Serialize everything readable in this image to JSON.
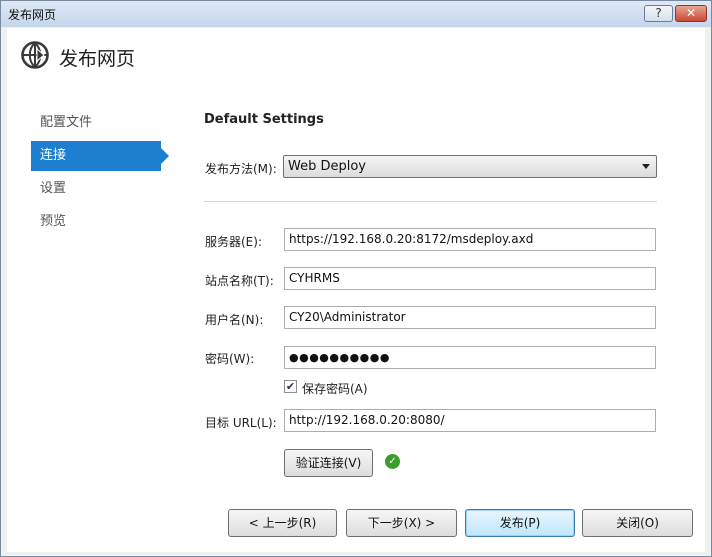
{
  "window": {
    "title": "发布网页",
    "help_label": "?",
    "close_label": "✕"
  },
  "header": {
    "title": "发布网页",
    "icon": "globe-publish-icon"
  },
  "nav": {
    "items": [
      {
        "label": "配置文件"
      },
      {
        "label": "连接"
      },
      {
        "label": "设置"
      },
      {
        "label": "预览"
      }
    ],
    "active_index": 1
  },
  "main": {
    "section_title": "Default Settings",
    "publish_method": {
      "label": "发布方法(M):",
      "value": "Web Deploy"
    },
    "server": {
      "label": "服务器(E):",
      "value": "https://192.168.0.20:8172/msdeploy.axd"
    },
    "site_name": {
      "label": "站点名称(T):",
      "value": "CYHRMS"
    },
    "username": {
      "label": "用户名(N):",
      "value": "CY20\\Administrator"
    },
    "password": {
      "label": "密码(W):",
      "value": "●●●●●●●●●●"
    },
    "save_password": {
      "label": "保存密码(A)",
      "checked": true
    },
    "target_url": {
      "label": "目标 URL(L):",
      "value": "http://192.168.0.20:8080/"
    },
    "validate_button": "验证连接(V)",
    "validation_status": "success"
  },
  "footer": {
    "prev": "< 上一步(R)",
    "next": "下一步(X) >",
    "publish": "发布(P)",
    "close": "关闭(O)"
  },
  "colors": {
    "accent": "#1e7fd0",
    "success": "#3a9e2a"
  }
}
